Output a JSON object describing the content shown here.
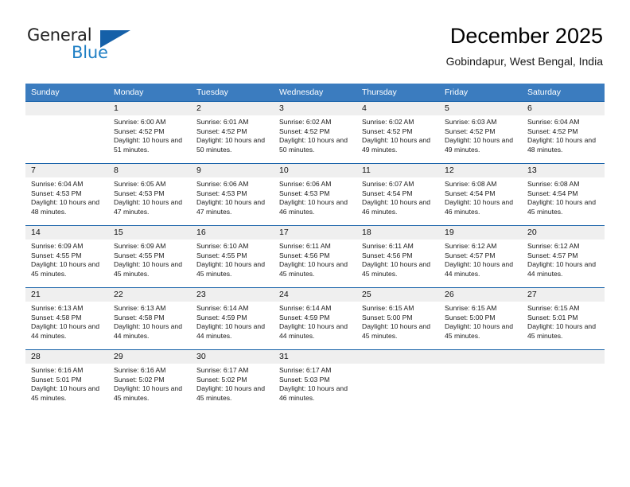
{
  "brand": {
    "line1": "General",
    "line2": "Blue",
    "triangle_color": "#1560a8",
    "blue_color": "#1f7fc4"
  },
  "header": {
    "title": "December 2025",
    "subtitle": "Gobindapur, West Bengal, India"
  },
  "theme": {
    "header_bg": "#3b7cbf",
    "row_divider": "#1560a8",
    "daynum_bg": "#efefef"
  },
  "weekday_headers": [
    "Sunday",
    "Monday",
    "Tuesday",
    "Wednesday",
    "Thursday",
    "Friday",
    "Saturday"
  ],
  "weeks": [
    [
      {
        "day": "",
        "sunrise": "",
        "sunset": "",
        "daylight": ""
      },
      {
        "day": "1",
        "sunrise": "Sunrise: 6:00 AM",
        "sunset": "Sunset: 4:52 PM",
        "daylight": "Daylight: 10 hours and 51 minutes."
      },
      {
        "day": "2",
        "sunrise": "Sunrise: 6:01 AM",
        "sunset": "Sunset: 4:52 PM",
        "daylight": "Daylight: 10 hours and 50 minutes."
      },
      {
        "day": "3",
        "sunrise": "Sunrise: 6:02 AM",
        "sunset": "Sunset: 4:52 PM",
        "daylight": "Daylight: 10 hours and 50 minutes."
      },
      {
        "day": "4",
        "sunrise": "Sunrise: 6:02 AM",
        "sunset": "Sunset: 4:52 PM",
        "daylight": "Daylight: 10 hours and 49 minutes."
      },
      {
        "day": "5",
        "sunrise": "Sunrise: 6:03 AM",
        "sunset": "Sunset: 4:52 PM",
        "daylight": "Daylight: 10 hours and 49 minutes."
      },
      {
        "day": "6",
        "sunrise": "Sunrise: 6:04 AM",
        "sunset": "Sunset: 4:52 PM",
        "daylight": "Daylight: 10 hours and 48 minutes."
      }
    ],
    [
      {
        "day": "7",
        "sunrise": "Sunrise: 6:04 AM",
        "sunset": "Sunset: 4:53 PM",
        "daylight": "Daylight: 10 hours and 48 minutes."
      },
      {
        "day": "8",
        "sunrise": "Sunrise: 6:05 AM",
        "sunset": "Sunset: 4:53 PM",
        "daylight": "Daylight: 10 hours and 47 minutes."
      },
      {
        "day": "9",
        "sunrise": "Sunrise: 6:06 AM",
        "sunset": "Sunset: 4:53 PM",
        "daylight": "Daylight: 10 hours and 47 minutes."
      },
      {
        "day": "10",
        "sunrise": "Sunrise: 6:06 AM",
        "sunset": "Sunset: 4:53 PM",
        "daylight": "Daylight: 10 hours and 46 minutes."
      },
      {
        "day": "11",
        "sunrise": "Sunrise: 6:07 AM",
        "sunset": "Sunset: 4:54 PM",
        "daylight": "Daylight: 10 hours and 46 minutes."
      },
      {
        "day": "12",
        "sunrise": "Sunrise: 6:08 AM",
        "sunset": "Sunset: 4:54 PM",
        "daylight": "Daylight: 10 hours and 46 minutes."
      },
      {
        "day": "13",
        "sunrise": "Sunrise: 6:08 AM",
        "sunset": "Sunset: 4:54 PM",
        "daylight": "Daylight: 10 hours and 45 minutes."
      }
    ],
    [
      {
        "day": "14",
        "sunrise": "Sunrise: 6:09 AM",
        "sunset": "Sunset: 4:55 PM",
        "daylight": "Daylight: 10 hours and 45 minutes."
      },
      {
        "day": "15",
        "sunrise": "Sunrise: 6:09 AM",
        "sunset": "Sunset: 4:55 PM",
        "daylight": "Daylight: 10 hours and 45 minutes."
      },
      {
        "day": "16",
        "sunrise": "Sunrise: 6:10 AM",
        "sunset": "Sunset: 4:55 PM",
        "daylight": "Daylight: 10 hours and 45 minutes."
      },
      {
        "day": "17",
        "sunrise": "Sunrise: 6:11 AM",
        "sunset": "Sunset: 4:56 PM",
        "daylight": "Daylight: 10 hours and 45 minutes."
      },
      {
        "day": "18",
        "sunrise": "Sunrise: 6:11 AM",
        "sunset": "Sunset: 4:56 PM",
        "daylight": "Daylight: 10 hours and 45 minutes."
      },
      {
        "day": "19",
        "sunrise": "Sunrise: 6:12 AM",
        "sunset": "Sunset: 4:57 PM",
        "daylight": "Daylight: 10 hours and 44 minutes."
      },
      {
        "day": "20",
        "sunrise": "Sunrise: 6:12 AM",
        "sunset": "Sunset: 4:57 PM",
        "daylight": "Daylight: 10 hours and 44 minutes."
      }
    ],
    [
      {
        "day": "21",
        "sunrise": "Sunrise: 6:13 AM",
        "sunset": "Sunset: 4:58 PM",
        "daylight": "Daylight: 10 hours and 44 minutes."
      },
      {
        "day": "22",
        "sunrise": "Sunrise: 6:13 AM",
        "sunset": "Sunset: 4:58 PM",
        "daylight": "Daylight: 10 hours and 44 minutes."
      },
      {
        "day": "23",
        "sunrise": "Sunrise: 6:14 AM",
        "sunset": "Sunset: 4:59 PM",
        "daylight": "Daylight: 10 hours and 44 minutes."
      },
      {
        "day": "24",
        "sunrise": "Sunrise: 6:14 AM",
        "sunset": "Sunset: 4:59 PM",
        "daylight": "Daylight: 10 hours and 44 minutes."
      },
      {
        "day": "25",
        "sunrise": "Sunrise: 6:15 AM",
        "sunset": "Sunset: 5:00 PM",
        "daylight": "Daylight: 10 hours and 45 minutes."
      },
      {
        "day": "26",
        "sunrise": "Sunrise: 6:15 AM",
        "sunset": "Sunset: 5:00 PM",
        "daylight": "Daylight: 10 hours and 45 minutes."
      },
      {
        "day": "27",
        "sunrise": "Sunrise: 6:15 AM",
        "sunset": "Sunset: 5:01 PM",
        "daylight": "Daylight: 10 hours and 45 minutes."
      }
    ],
    [
      {
        "day": "28",
        "sunrise": "Sunrise: 6:16 AM",
        "sunset": "Sunset: 5:01 PM",
        "daylight": "Daylight: 10 hours and 45 minutes."
      },
      {
        "day": "29",
        "sunrise": "Sunrise: 6:16 AM",
        "sunset": "Sunset: 5:02 PM",
        "daylight": "Daylight: 10 hours and 45 minutes."
      },
      {
        "day": "30",
        "sunrise": "Sunrise: 6:17 AM",
        "sunset": "Sunset: 5:02 PM",
        "daylight": "Daylight: 10 hours and 45 minutes."
      },
      {
        "day": "31",
        "sunrise": "Sunrise: 6:17 AM",
        "sunset": "Sunset: 5:03 PM",
        "daylight": "Daylight: 10 hours and 46 minutes."
      },
      {
        "day": "",
        "sunrise": "",
        "sunset": "",
        "daylight": ""
      },
      {
        "day": "",
        "sunrise": "",
        "sunset": "",
        "daylight": ""
      },
      {
        "day": "",
        "sunrise": "",
        "sunset": "",
        "daylight": ""
      }
    ]
  ]
}
